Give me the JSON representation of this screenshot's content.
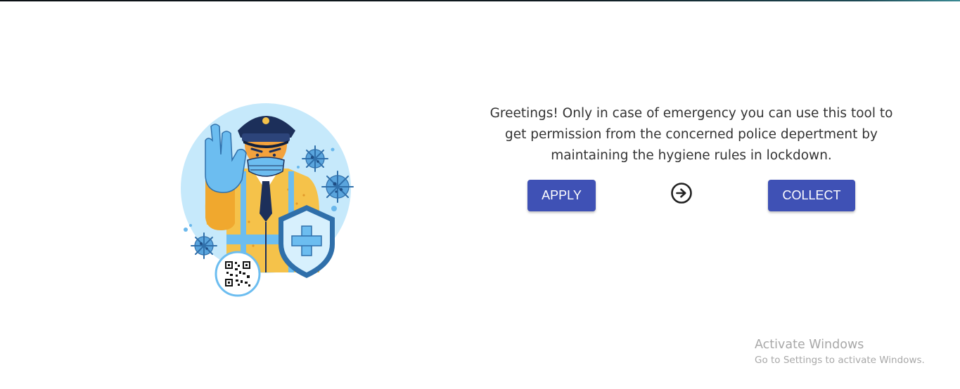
{
  "hero": {
    "message": "Greetings! Only in case of emergency you can use this tool to get permission from the concerned police depertment by maintaining the hygiene rules in lockdown."
  },
  "actions": {
    "apply_label": "APPLY",
    "collect_label": "COLLECT",
    "arrow_icon": "arrow-right-circle-icon"
  },
  "watermark": {
    "title": "Activate Windows",
    "subtitle": "Go to Settings to activate Windows."
  },
  "colors": {
    "button_bg": "#3f51b5",
    "button_text": "#ffffff",
    "text": "#333333",
    "illustration_circle": "#c6e9fb",
    "watermark_text": "#a8a8a8"
  }
}
